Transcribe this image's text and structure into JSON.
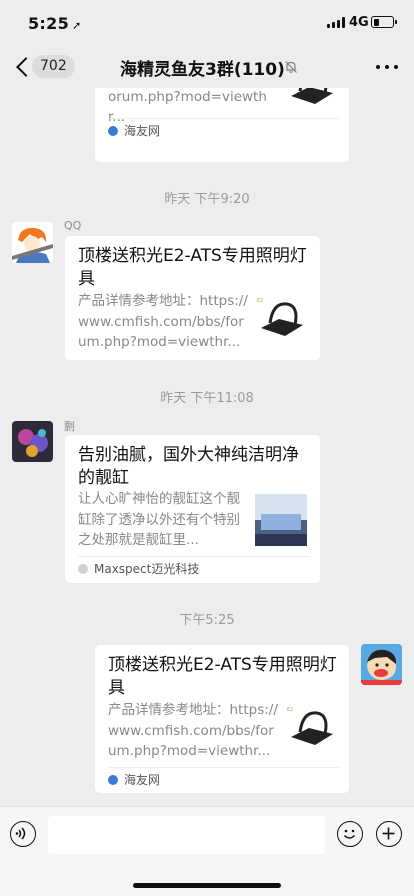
{
  "status": {
    "time": "5:25",
    "network": "4G",
    "battery_level": 0.3
  },
  "nav": {
    "back_count": "702",
    "title": "海精灵鱼友3群(110)"
  },
  "messages": [
    {
      "desc": "://www.cmfish.com/bbs/forum.php?mod=viewthr...",
      "source": "海友网"
    },
    {
      "timestamp": "昨天 下午9:20"
    },
    {
      "sender": "QQ",
      "title": "顶楼送积光E2-ATS专用照明灯具",
      "desc": "产品详情参考地址：https://www.cmfish.com/bbs/forum.php?mod=viewthr..."
    },
    {
      "timestamp": "昨天 下午11:08"
    },
    {
      "sender": "剽",
      "title": "告别油腻，国外大神纯洁明净的靓缸",
      "desc": "让人心旷神怡的靓缸这个靓缸除了透净以外还有个特别之处那就是靓缸里...",
      "source": "Maxspect迈光科技"
    },
    {
      "timestamp": "下午5:25"
    },
    {
      "title": "顶楼送积光E2-ATS专用照明灯具",
      "desc": "产品详情参考地址：https://www.cmfish.com/bbs/forum.php?mod=viewthr...",
      "source": "海友网"
    }
  ],
  "icons": {
    "back": "chevron-left-icon",
    "mute": "mute-bell-icon",
    "more": "more-dots-icon",
    "voice": "voice-icon",
    "emoji": "emoji-icon",
    "plus": "plus-icon"
  },
  "colors": {
    "background": "#ededed",
    "bubble": "#ffffff",
    "muted_text": "#888888"
  }
}
